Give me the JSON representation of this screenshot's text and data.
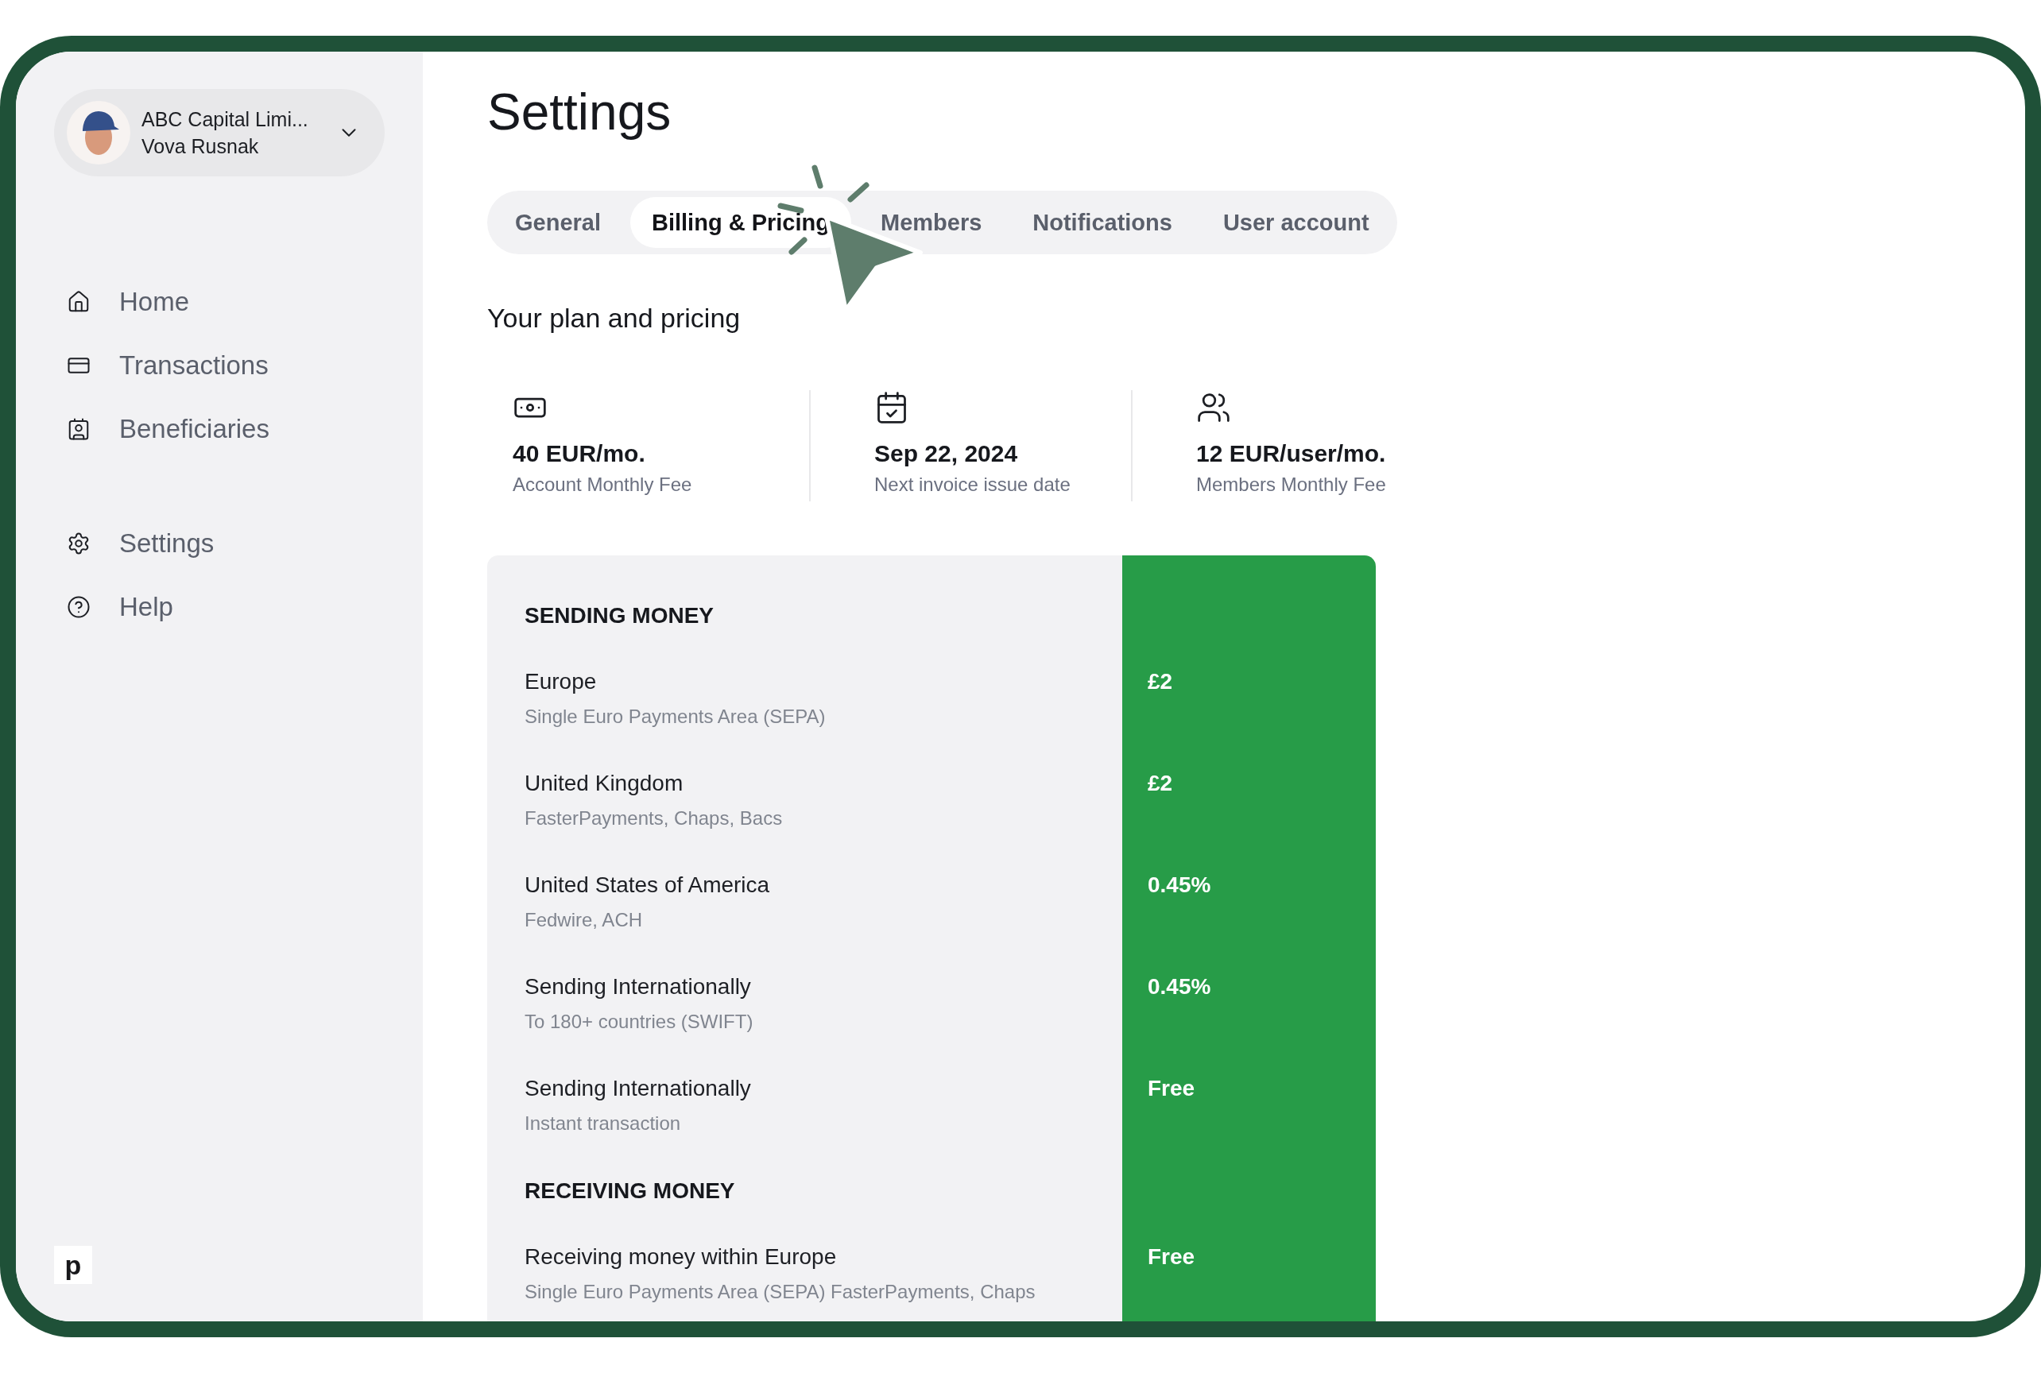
{
  "sidebar": {
    "account": {
      "company": "ABC Capital Limi...",
      "user": "Vova Rusnak"
    },
    "nav": [
      {
        "label": "Home"
      },
      {
        "label": "Transactions"
      },
      {
        "label": "Beneficiaries"
      },
      {
        "label": "Settings"
      },
      {
        "label": "Help"
      }
    ],
    "logo": "p"
  },
  "main": {
    "title": "Settings",
    "tabs": [
      {
        "label": "General",
        "selected": false
      },
      {
        "label": "Billing & Pricing",
        "selected": true
      },
      {
        "label": "Members",
        "selected": false
      },
      {
        "label": "Notifications",
        "selected": false
      },
      {
        "label": "User account",
        "selected": false
      }
    ],
    "section_title": "Your plan and pricing",
    "stats": [
      {
        "value": "40 EUR/mo.",
        "label": "Account Monthly Fee"
      },
      {
        "value": "Sep 22, 2024",
        "label": "Next invoice issue date"
      },
      {
        "value": "12 EUR/user/mo.",
        "label": "Members Monthly Fee"
      }
    ],
    "pricing": [
      {
        "kind": "section",
        "title": "SENDING MONEY"
      },
      {
        "kind": "item",
        "name": "Europe",
        "detail": "Single Euro Payments Area (SEPA)",
        "price": "£2"
      },
      {
        "kind": "item",
        "name": "United Kingdom",
        "detail": "FasterPayments, Chaps, Bacs",
        "price": "£2"
      },
      {
        "kind": "item",
        "name": "United States of America",
        "detail": "Fedwire, ACH",
        "price": "0.45%"
      },
      {
        "kind": "item",
        "name": "Sending Internationally",
        "detail": "To 180+ countries (SWIFT)",
        "price": "0.45%"
      },
      {
        "kind": "item",
        "name": "Sending Internationally",
        "detail": "Instant transaction",
        "price": "Free"
      },
      {
        "kind": "section",
        "title": "RECEIVING MONEY"
      },
      {
        "kind": "item",
        "name": "Receiving money within Europe",
        "detail": "Single Euro Payments Area (SEPA) FasterPayments, Chaps",
        "price": "Free"
      }
    ]
  }
}
